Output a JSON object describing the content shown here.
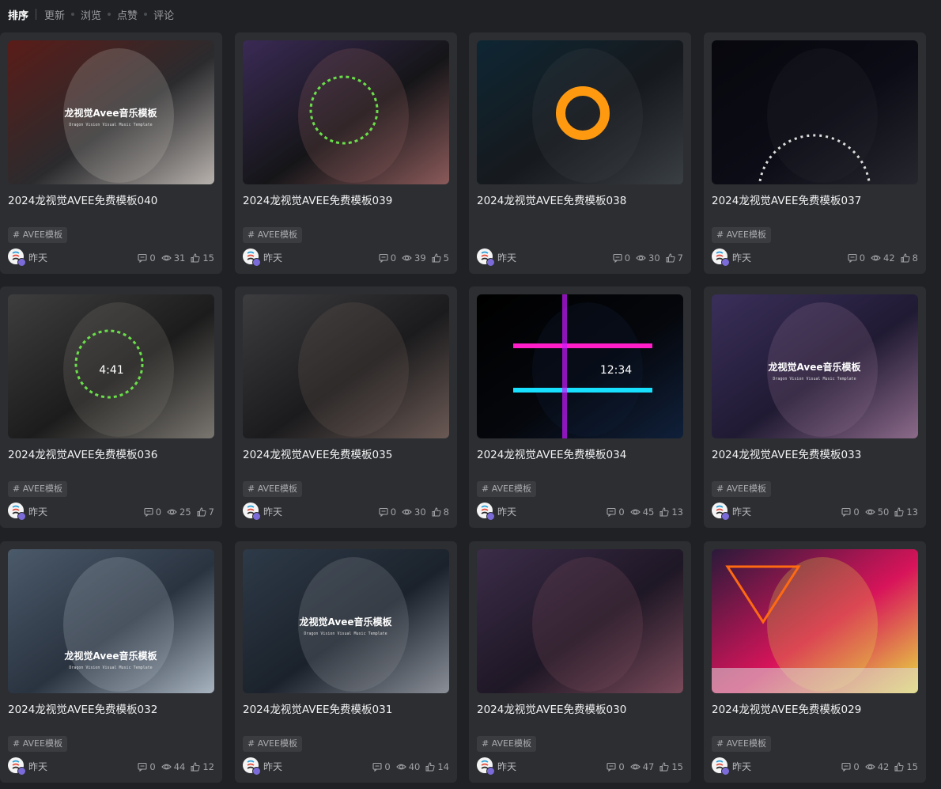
{
  "sort": {
    "title": "排序",
    "options": [
      "更新",
      "浏览",
      "点赞",
      "评论"
    ]
  },
  "colors": {
    "page_bg": "#1f2124",
    "card_bg": "#2c2e32",
    "tag_bg": "#3a3c40",
    "badge": "#7b6bd8"
  },
  "cards": [
    {
      "title": "2024龙视觉AVEE免费模板040",
      "tag": "# AVEE模板",
      "author": "昨天",
      "comments": "0",
      "views": "31",
      "likes": "15",
      "thumb_caption": "龙视觉Avee音乐模板",
      "thumb_sub": "Dragon Vision Visual Music Template",
      "thumb_theme": [
        "#5a1c18",
        "#2b2b2e",
        "#b8b2ad"
      ]
    },
    {
      "title": "2024龙视觉AVEE免费模板039",
      "tag": "# AVEE模板",
      "author": "昨天",
      "comments": "0",
      "views": "39",
      "likes": "5",
      "thumb_caption": "",
      "thumb_sub": "",
      "thumb_theme": [
        "#3a2a55",
        "#151518",
        "#8b5a5a"
      ]
    },
    {
      "title": "2024龙视觉AVEE免费模板038",
      "tag": "",
      "author": "昨天",
      "comments": "0",
      "views": "30",
      "likes": "7",
      "thumb_caption": "",
      "thumb_sub": "",
      "thumb_theme": [
        "#0e2633",
        "#16191d",
        "#3a3f44"
      ]
    },
    {
      "title": "2024龙视觉AVEE免费模板037",
      "tag": "# AVEE模板",
      "author": "昨天",
      "comments": "0",
      "views": "42",
      "likes": "8",
      "thumb_caption": "",
      "thumb_sub": "",
      "thumb_theme": [
        "#07070d",
        "#0c0c16",
        "#26262e"
      ]
    },
    {
      "title": "2024龙视觉AVEE免费模板036",
      "tag": "# AVEE模板",
      "author": "昨天",
      "comments": "0",
      "views": "25",
      "likes": "7",
      "thumb_caption": "",
      "thumb_sub": "",
      "thumb_theme": [
        "#3e3e3e",
        "#1c1c1c",
        "#7a7670"
      ],
      "thumb_text": "4:41"
    },
    {
      "title": "2024龙视觉AVEE免费模板035",
      "tag": "# AVEE模板",
      "author": "昨天",
      "comments": "0",
      "views": "30",
      "likes": "8",
      "thumb_caption": "",
      "thumb_sub": "",
      "thumb_theme": [
        "#3d3d40",
        "#1b1b1d",
        "#6b5a55"
      ]
    },
    {
      "title": "2024龙视觉AVEE免费模板034",
      "tag": "# AVEE模板",
      "author": "昨天",
      "comments": "0",
      "views": "45",
      "likes": "13",
      "thumb_caption": "",
      "thumb_sub": "",
      "thumb_theme": [
        "#000000",
        "#05070c",
        "#10203a"
      ],
      "thumb_text": "12:34"
    },
    {
      "title": "2024龙视觉AVEE免费模板033",
      "tag": "# AVEE模板",
      "author": "昨天",
      "comments": "0",
      "views": "50",
      "likes": "13",
      "thumb_caption": "龙视觉Avee音乐模板",
      "thumb_sub": "Dragon Vision Visual Music Template",
      "thumb_theme": [
        "#3a2f5a",
        "#201a33",
        "#8c6a8a"
      ]
    },
    {
      "title": "2024龙视觉AVEE免费模板032",
      "tag": "# AVEE模板",
      "author": "昨天",
      "comments": "0",
      "views": "44",
      "likes": "12",
      "thumb_caption": "龙视觉Avee音乐模板",
      "thumb_sub": "Dragon Vision Visual Music Template",
      "thumb_theme": [
        "#4b5a6a",
        "#2a3340",
        "#a8b4c0"
      ]
    },
    {
      "title": "2024龙视觉AVEE免费模板031",
      "tag": "# AVEE模板",
      "author": "昨天",
      "comments": "0",
      "views": "40",
      "likes": "14",
      "thumb_caption": "龙视觉Avee音乐模板",
      "thumb_sub": "Dragon Vision Visual Music Template",
      "thumb_theme": [
        "#2e3a48",
        "#1b222b",
        "#8a8f98"
      ]
    },
    {
      "title": "2024龙视觉AVEE免费模板030",
      "tag": "# AVEE模板",
      "author": "昨天",
      "comments": "0",
      "views": "47",
      "likes": "15",
      "thumb_caption": "",
      "thumb_sub": "",
      "thumb_theme": [
        "#3b2c48",
        "#1e1725",
        "#7a4a5a"
      ]
    },
    {
      "title": "2024龙视觉AVEE免费模板029",
      "tag": "# AVEE模板",
      "author": "昨天",
      "comments": "0",
      "views": "42",
      "likes": "15",
      "thumb_caption": "",
      "thumb_sub": "",
      "thumb_theme": [
        "#2a1a3a",
        "#d8145a",
        "#e8e040"
      ]
    }
  ]
}
